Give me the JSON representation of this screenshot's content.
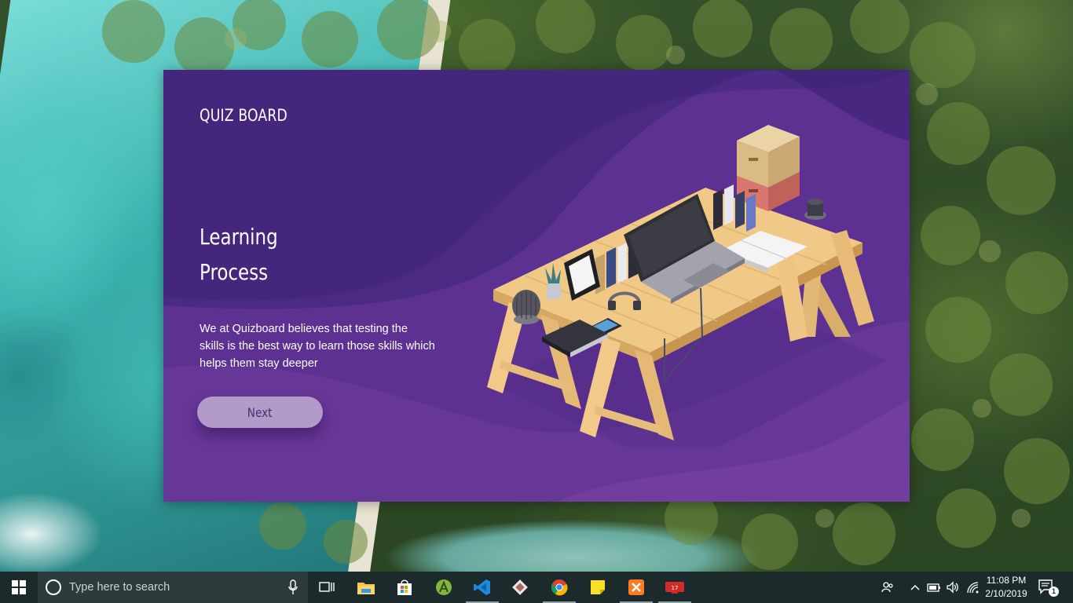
{
  "app": {
    "brand": "QUIZ BOARD",
    "headline_line1": "Learning",
    "headline_line2": "Process",
    "description": "We at Quizboard believes that testing the skills is the best way to learn those skills which helps them stay deeper",
    "next_label": "Next",
    "colors": {
      "background": "#5b3190",
      "button": "#b29ac9",
      "button_text": "#4a2f70"
    }
  },
  "taskbar": {
    "search_placeholder": "Type here to search",
    "pinned_icons": [
      "task-view-icon",
      "file-explorer-icon",
      "microsoft-store-icon",
      "android-studio-icon",
      "vscode-icon",
      "git-icon",
      "chrome-icon",
      "sticky-notes-icon",
      "xampp-icon",
      "terminal-app-icon"
    ],
    "tray_icons": [
      "people-icon",
      "chevron-up-icon",
      "battery-icon",
      "volume-icon",
      "wifi-icon"
    ],
    "clock_time": "11:08 PM",
    "clock_date": "2/10/2019",
    "notification_count": "1"
  }
}
